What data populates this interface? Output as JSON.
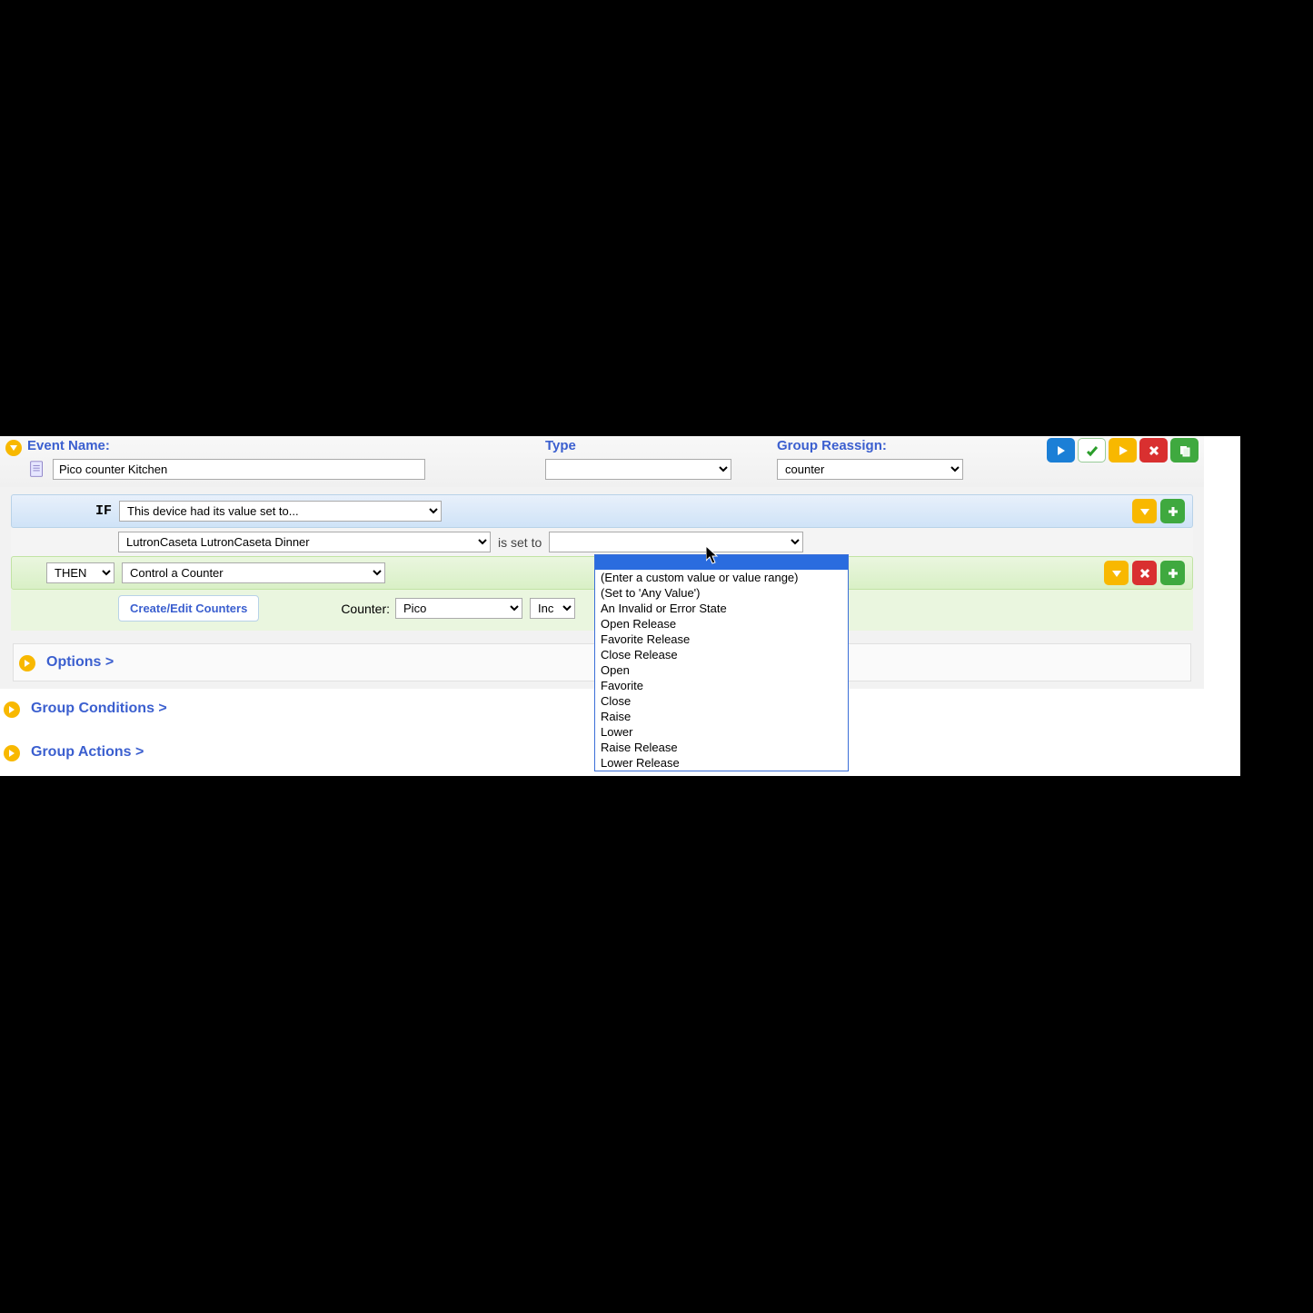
{
  "header": {
    "event_name_label": "Event Name:",
    "event_name_value": "Pico counter Kitchen",
    "type_label": "Type",
    "type_value": "",
    "group_label": "Group Reassign:",
    "group_value": "counter"
  },
  "if_row": {
    "label": "IF",
    "condition_value": "This device had its value set to..."
  },
  "device_row": {
    "device_value": "LutronCaseta LutronCaseta Dinner",
    "is_set_to": "is set to",
    "value_select": ""
  },
  "dropdown_options": [
    "",
    "(Enter a custom value or value range)",
    "(Set to 'Any Value')",
    "An Invalid or Error State",
    "Open Release",
    "Favorite Release",
    "Close Release",
    "Open",
    "Favorite",
    "Close",
    "Raise",
    "Lower",
    "Raise Release",
    "Lower Release"
  ],
  "then_row": {
    "then_label": "THEN",
    "action_value": "Control a Counter"
  },
  "counter_row": {
    "button_label": "Create/Edit Counters",
    "counter_label": "Counter:",
    "counter_value": "Pico",
    "inc_value": "Inc"
  },
  "sections": {
    "options": "Options >",
    "group_conditions": "Group Conditions >",
    "group_actions": "Group Actions >"
  }
}
